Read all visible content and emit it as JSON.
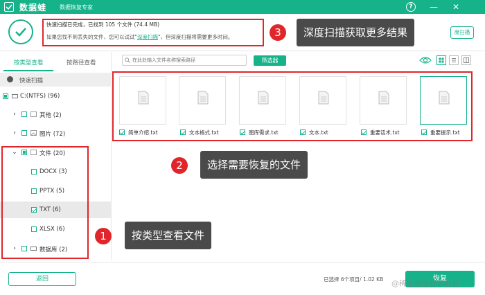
{
  "titlebar": {
    "app_name": "数据蛙",
    "subtitle": "数据恢复专家",
    "help": "?",
    "minimize": "—",
    "close": "✕"
  },
  "status": {
    "line1": "快速扫描已完成，已找到 105 个文件 (74.4 MB)",
    "line2_prefix": "如果您找不到丢失的文件，您可以试试\"",
    "line2_link": "深度扫描",
    "line2_suffix": "\"，但深度扫描将需要更多时间。",
    "deep_button": "度扫描"
  },
  "callouts": [
    {
      "num": "3",
      "text": "深度扫描获取更多结果"
    },
    {
      "num": "2",
      "text": "选择需要恢复的文件"
    },
    {
      "num": "1",
      "text": "按类型查看文件"
    }
  ],
  "sidebar": {
    "tab_type": "按类型查看",
    "tab_path": "按路径查看",
    "quick_scan": "快速扫描",
    "tree": [
      {
        "label": "C:(NTFS) (96)"
      },
      {
        "label": "其他 (2)"
      },
      {
        "label": "图片 (72)"
      },
      {
        "label": "文件 (20)"
      },
      {
        "label": "DOCX (3)"
      },
      {
        "label": "PPTX (5)"
      },
      {
        "label": "TXT (6)"
      },
      {
        "label": "XLSX (6)"
      },
      {
        "label": "数据库 (2)"
      }
    ]
  },
  "toolbar": {
    "search_placeholder": "在此处输入文件名称搜索路径",
    "filter": "筛选器"
  },
  "files": [
    {
      "name": "简单介绍.txt"
    },
    {
      "name": "文本格式.txt"
    },
    {
      "name": "图库需求.txt"
    },
    {
      "name": "文本.txt"
    },
    {
      "name": "重要话术.txt"
    },
    {
      "name": "重要提示.txt"
    }
  ],
  "footer": {
    "back": "返回",
    "selection": "已选择 6个项目/ 1.02 KB",
    "recover": "恢复",
    "watermark": "@稀土掘金技术社区"
  },
  "colors": {
    "brand": "#16b28a",
    "annotation_red": "#e0262b",
    "callout_bg": "#4a4a4a"
  }
}
